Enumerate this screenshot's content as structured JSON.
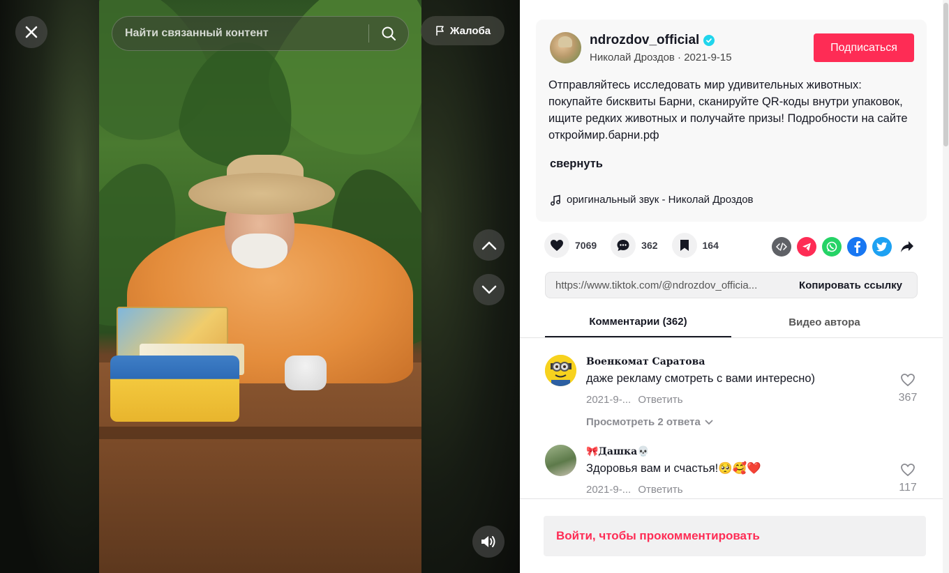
{
  "colors": {
    "accent": "#fe2c55",
    "verified": "#20d5ec"
  },
  "video": {
    "search_placeholder": "Найти связанный контент",
    "report_label": "Жалоба",
    "icons": [
      "close-icon",
      "search-icon",
      "flag-icon",
      "chevron-up-icon",
      "chevron-down-icon",
      "volume-icon"
    ]
  },
  "author": {
    "username": "ndrozdov_official",
    "display_name": "Николай Дроздов",
    "date": "2021-9-15",
    "sub_line": "Николай Дроздов · 2021-9-15",
    "follow_label": "Подписаться",
    "description": "Отправляйтесь исследовать мир удивительных животных: покупайте бисквиты Барни, сканируйте QR-коды внутри упаковок, ищите редких животных и получайте призы! Подробности на сайте откроймир.барни.рф",
    "collapse_label": "свернуть",
    "music": "оригинальный звук - Николай Дроздов"
  },
  "actions": {
    "likes": "7069",
    "comments": "362",
    "saves": "164"
  },
  "share": {
    "icons": [
      "embed-icon",
      "telegram-icon",
      "whatsapp-icon",
      "facebook-icon",
      "twitter-icon",
      "share-arrow-icon"
    ],
    "link": "https://www.tiktok.com/@ndrozdov_official/video/",
    "link_display": "https://www.tiktok.com/@ndrozdov_officia...",
    "copy_label": "Копировать ссылку"
  },
  "tabs": [
    {
      "label": "Комментарии (362)",
      "active": true
    },
    {
      "label": "Видео автора",
      "active": false
    }
  ],
  "comments": [
    {
      "name": "Военкомат Саратова",
      "text": "даже рекламу смотреть с вами интересно)",
      "date": "2021-9-...",
      "reply_label": "Ответить",
      "likes": "367",
      "replies_label": "Просмотреть 2 ответа"
    },
    {
      "name": "🎀Дашка💀",
      "text": "Здоровья вам и счастья!🥺🥰❤️",
      "date": "2021-9-...",
      "reply_label": "Ответить",
      "likes": "117"
    }
  ],
  "login_prompt": "Войти, чтобы прокомментировать"
}
